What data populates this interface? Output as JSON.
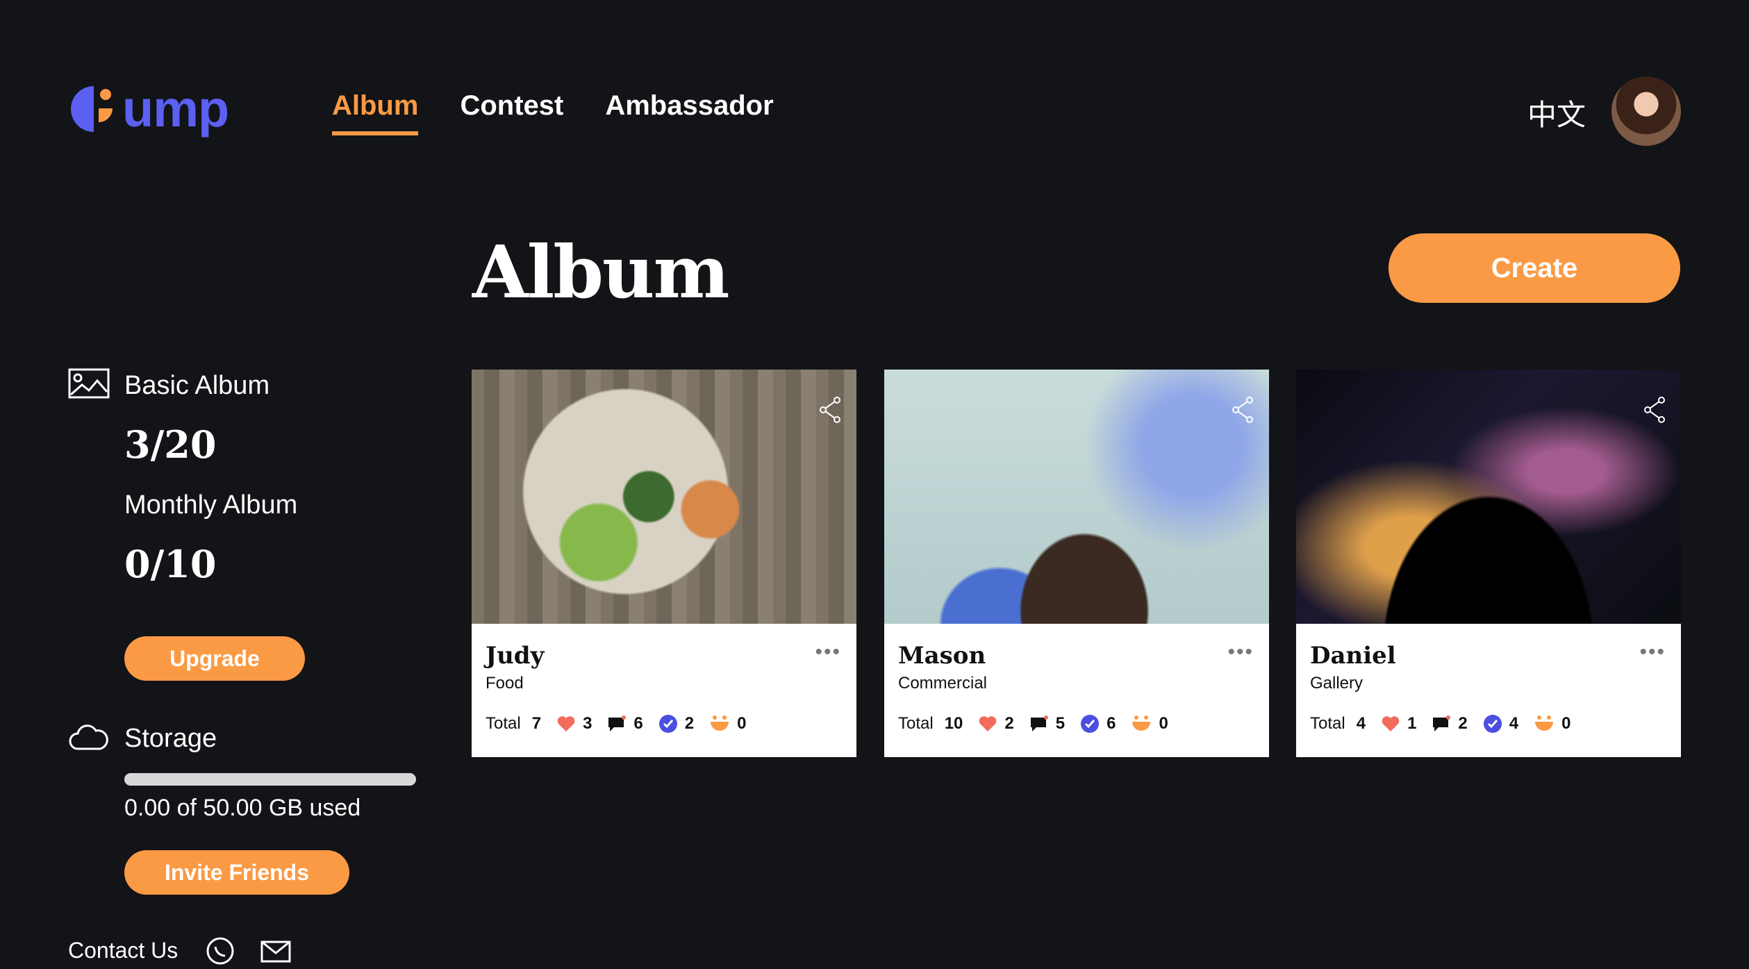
{
  "header": {
    "logo_text": "ump",
    "nav": [
      {
        "label": "Album",
        "active": true
      },
      {
        "label": "Contest",
        "active": false
      },
      {
        "label": "Ambassador",
        "active": false
      }
    ],
    "language": "中文"
  },
  "main": {
    "title": "Album",
    "create_label": "Create"
  },
  "sidebar": {
    "basic_album_label": "Basic Album",
    "basic_album_count": "3/20",
    "monthly_album_label": "Monthly Album",
    "monthly_album_count": "0/10",
    "upgrade_label": "Upgrade",
    "storage_label": "Storage",
    "storage_used_fraction": 0,
    "storage_text": "0.00 of 50.00 GB used",
    "invite_label": "Invite Friends",
    "contact_label": "Contact Us"
  },
  "cards": [
    {
      "name": "Judy",
      "category": "Food",
      "total_label": "Total",
      "total": "7",
      "likes": "3",
      "comments": "6",
      "approved": "2",
      "smiles": "0"
    },
    {
      "name": "Mason",
      "category": "Commercial",
      "total_label": "Total",
      "total": "10",
      "likes": "2",
      "comments": "5",
      "approved": "6",
      "smiles": "0"
    },
    {
      "name": "Daniel",
      "category": "Gallery",
      "total_label": "Total",
      "total": "4",
      "likes": "1",
      "comments": "2",
      "approved": "4",
      "smiles": "0"
    }
  ],
  "colors": {
    "background": "#121417",
    "accent": "#fb9a45",
    "brand": "#5b5ff2",
    "like": "#f26b5b",
    "approved": "#4a4fe0"
  }
}
